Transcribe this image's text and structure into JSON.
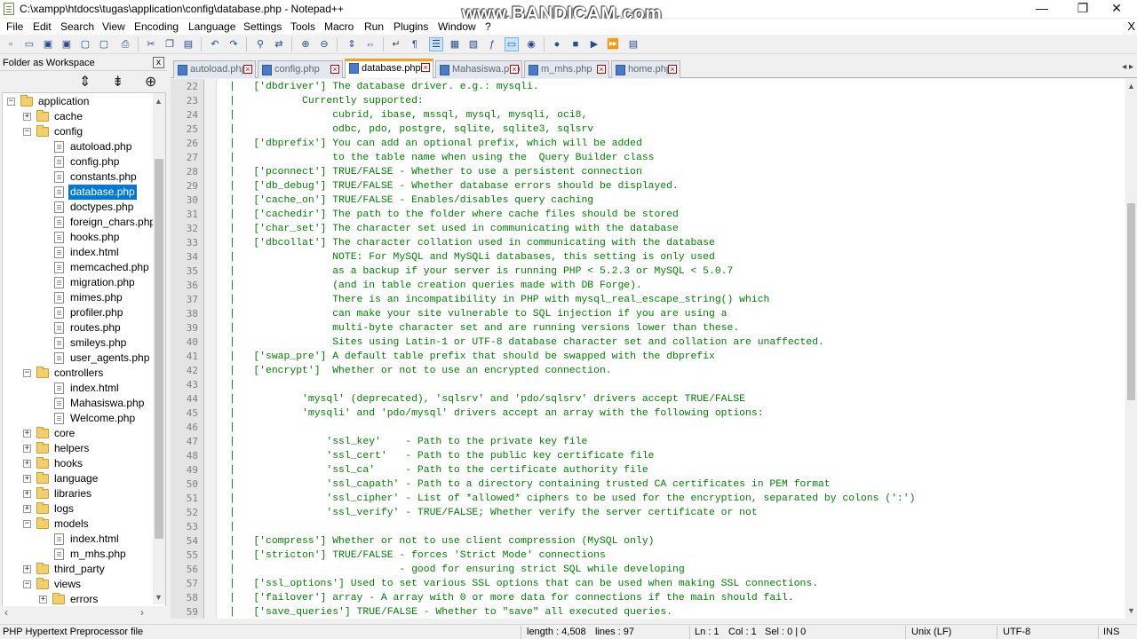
{
  "window": {
    "title": "C:\\xampp\\htdocs\\tugas\\application\\config\\database.php - Notepad++",
    "watermark": "www.BANDICAM.com",
    "minimize": "—",
    "maximize": "❐",
    "close": "✕"
  },
  "menu": [
    "File",
    "Edit",
    "Search",
    "View",
    "Encoding",
    "Language",
    "Settings",
    "Tools",
    "Macro",
    "Run",
    "Plugins",
    "Window",
    "?"
  ],
  "menu_close": "X",
  "workspace": {
    "title": "Folder as Workspace",
    "close": "x",
    "tools": [
      "collapse-all-icon",
      "expand-all-icon",
      "locate-current-file-icon"
    ],
    "tree": [
      {
        "label": "application",
        "type": "folder",
        "level": 0,
        "expanded": true
      },
      {
        "label": "cache",
        "type": "folder",
        "level": 1,
        "expanded": false
      },
      {
        "label": "config",
        "type": "folder",
        "level": 1,
        "expanded": true
      },
      {
        "label": "autoload.php",
        "type": "file",
        "level": 2
      },
      {
        "label": "config.php",
        "type": "file",
        "level": 2
      },
      {
        "label": "constants.php",
        "type": "file",
        "level": 2
      },
      {
        "label": "database.php",
        "type": "file",
        "level": 2,
        "selected": true
      },
      {
        "label": "doctypes.php",
        "type": "file",
        "level": 2
      },
      {
        "label": "foreign_chars.php",
        "type": "file",
        "level": 2
      },
      {
        "label": "hooks.php",
        "type": "file",
        "level": 2
      },
      {
        "label": "index.html",
        "type": "file",
        "level": 2
      },
      {
        "label": "memcached.php",
        "type": "file",
        "level": 2
      },
      {
        "label": "migration.php",
        "type": "file",
        "level": 2
      },
      {
        "label": "mimes.php",
        "type": "file",
        "level": 2
      },
      {
        "label": "profiler.php",
        "type": "file",
        "level": 2
      },
      {
        "label": "routes.php",
        "type": "file",
        "level": 2
      },
      {
        "label": "smileys.php",
        "type": "file",
        "level": 2
      },
      {
        "label": "user_agents.php",
        "type": "file",
        "level": 2
      },
      {
        "label": "controllers",
        "type": "folder",
        "level": 1,
        "expanded": true
      },
      {
        "label": "index.html",
        "type": "file",
        "level": 2
      },
      {
        "label": "Mahasiswa.php",
        "type": "file",
        "level": 2
      },
      {
        "label": "Welcome.php",
        "type": "file",
        "level": 2
      },
      {
        "label": "core",
        "type": "folder",
        "level": 1,
        "expanded": false
      },
      {
        "label": "helpers",
        "type": "folder",
        "level": 1,
        "expanded": false
      },
      {
        "label": "hooks",
        "type": "folder",
        "level": 1,
        "expanded": false
      },
      {
        "label": "language",
        "type": "folder",
        "level": 1,
        "expanded": false
      },
      {
        "label": "libraries",
        "type": "folder",
        "level": 1,
        "expanded": false
      },
      {
        "label": "logs",
        "type": "folder",
        "level": 1,
        "expanded": false
      },
      {
        "label": "models",
        "type": "folder",
        "level": 1,
        "expanded": true
      },
      {
        "label": "index.html",
        "type": "file",
        "level": 2
      },
      {
        "label": "m_mhs.php",
        "type": "file",
        "level": 2
      },
      {
        "label": "third_party",
        "type": "folder",
        "level": 1,
        "expanded": false
      },
      {
        "label": "views",
        "type": "folder",
        "level": 1,
        "expanded": true
      },
      {
        "label": "errors",
        "type": "folder",
        "level": 2,
        "expanded": false
      }
    ]
  },
  "tabs": [
    {
      "label": "autoload.php",
      "active": false
    },
    {
      "label": "config.php",
      "active": false
    },
    {
      "label": "database.php",
      "active": true
    },
    {
      "label": "Mahasiswa.php",
      "active": false
    },
    {
      "label": "m_mhs.php",
      "active": false
    },
    {
      "label": "home.php",
      "active": false
    }
  ],
  "editor": {
    "lines": [
      {
        "n": "22",
        "text": "|   ['dbdriver'] The database driver. e.g.: mysqli."
      },
      {
        "n": "23",
        "text": "|           Currently supported:"
      },
      {
        "n": "24",
        "text": "|                cubrid, ibase, mssql, mysql, mysqli, oci8,"
      },
      {
        "n": "25",
        "text": "|                odbc, pdo, postgre, sqlite, sqlite3, sqlsrv"
      },
      {
        "n": "26",
        "text": "|   ['dbprefix'] You can add an optional prefix, which will be added"
      },
      {
        "n": "27",
        "text": "|                to the table name when using the  Query Builder class"
      },
      {
        "n": "28",
        "text": "|   ['pconnect'] TRUE/FALSE - Whether to use a persistent connection"
      },
      {
        "n": "29",
        "text": "|   ['db_debug'] TRUE/FALSE - Whether database errors should be displayed."
      },
      {
        "n": "30",
        "text": "|   ['cache_on'] TRUE/FALSE - Enables/disables query caching"
      },
      {
        "n": "31",
        "text": "|   ['cachedir'] The path to the folder where cache files should be stored"
      },
      {
        "n": "32",
        "text": "|   ['char_set'] The character set used in communicating with the database"
      },
      {
        "n": "33",
        "text": "|   ['dbcollat'] The character collation used in communicating with the database"
      },
      {
        "n": "34",
        "text": "|                NOTE: For MySQL and MySQLi databases, this setting is only used"
      },
      {
        "n": "35",
        "text": "|                as a backup if your server is running PHP < 5.2.3 or MySQL < 5.0.7"
      },
      {
        "n": "36",
        "text": "|                (and in table creation queries made with DB Forge)."
      },
      {
        "n": "37",
        "text": "|                There is an incompatibility in PHP with mysql_real_escape_string() which"
      },
      {
        "n": "38",
        "text": "|                can make your site vulnerable to SQL injection if you are using a"
      },
      {
        "n": "39",
        "text": "|                multi-byte character set and are running versions lower than these."
      },
      {
        "n": "40",
        "text": "|                Sites using Latin-1 or UTF-8 database character set and collation are unaffected."
      },
      {
        "n": "41",
        "text": "|   ['swap_pre'] A default table prefix that should be swapped with the dbprefix"
      },
      {
        "n": "42",
        "text": "|   ['encrypt']  Whether or not to use an encrypted connection."
      },
      {
        "n": "43",
        "text": "|"
      },
      {
        "n": "44",
        "text": "|           'mysql' (deprecated), 'sqlsrv' and 'pdo/sqlsrv' drivers accept TRUE/FALSE"
      },
      {
        "n": "45",
        "text": "|           'mysqli' and 'pdo/mysql' drivers accept an array with the following options:"
      },
      {
        "n": "46",
        "text": "|"
      },
      {
        "n": "47",
        "text": "|               'ssl_key'    - Path to the private key file"
      },
      {
        "n": "48",
        "text": "|               'ssl_cert'   - Path to the public key certificate file"
      },
      {
        "n": "49",
        "text": "|               'ssl_ca'     - Path to the certificate authority file"
      },
      {
        "n": "50",
        "text": "|               'ssl_capath' - Path to a directory containing trusted CA certificates in PEM format"
      },
      {
        "n": "51",
        "text": "|               'ssl_cipher' - List of *allowed* ciphers to be used for the encryption, separated by colons (':')"
      },
      {
        "n": "52",
        "text": "|               'ssl_verify' - TRUE/FALSE; Whether verify the server certificate or not"
      },
      {
        "n": "53",
        "text": "|"
      },
      {
        "n": "54",
        "text": "|   ['compress'] Whether or not to use client compression (MySQL only)"
      },
      {
        "n": "55",
        "text": "|   ['stricton'] TRUE/FALSE - forces 'Strict Mode' connections"
      },
      {
        "n": "56",
        "text": "|                           - good for ensuring strict SQL while developing"
      },
      {
        "n": "57",
        "text": "|   ['ssl_options'] Used to set various SSL options that can be used when making SSL connections."
      },
      {
        "n": "58",
        "text": "|   ['failover'] array - A array with 0 or more data for connections if the main should fail."
      },
      {
        "n": "59",
        "text": "|   ['save_queries'] TRUE/FALSE - Whether to \"save\" all executed queries."
      }
    ]
  },
  "status": {
    "filetype": "PHP Hypertext Preprocessor file",
    "length": "length : 4,508",
    "lines": "lines : 97",
    "ln": "Ln : 1",
    "col": "Col : 1",
    "sel": "Sel : 0 | 0",
    "eol": "Unix (LF)",
    "encoding": "UTF-8",
    "ins": "INS"
  },
  "colors": {
    "comment": "#008000",
    "active_tab_accent": "#fa9f1b",
    "selection": "#0078d7"
  }
}
